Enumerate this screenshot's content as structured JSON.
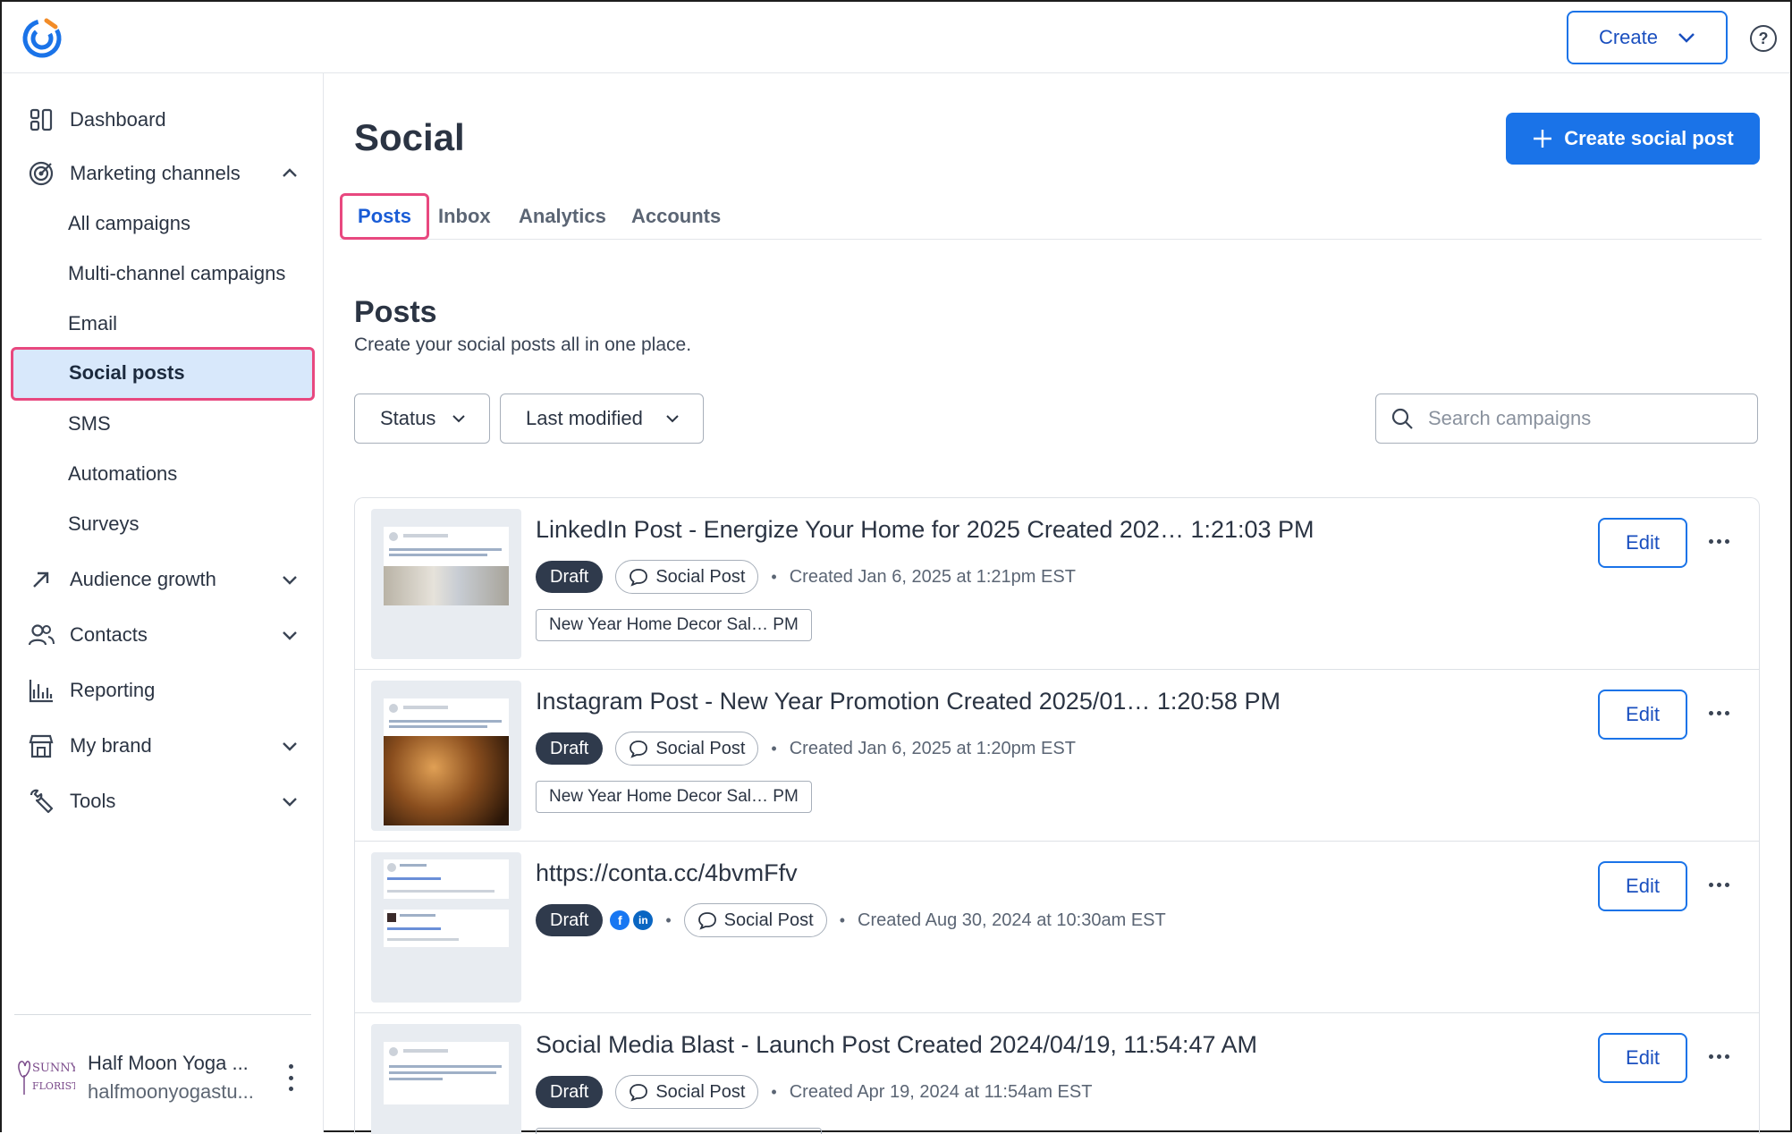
{
  "header": {
    "create_label": "Create",
    "help_icon": "help-circle-icon"
  },
  "sidebar": {
    "items": [
      {
        "label": "Dashboard",
        "icon": "dashboard-icon"
      },
      {
        "label": "Marketing channels",
        "icon": "target-icon"
      },
      {
        "label": "Audience growth",
        "icon": "arrow-up-right-icon"
      },
      {
        "label": "Contacts",
        "icon": "contacts-icon"
      },
      {
        "label": "Reporting",
        "icon": "chart-icon"
      },
      {
        "label": "My brand",
        "icon": "store-icon"
      },
      {
        "label": "Tools",
        "icon": "wrench-icon"
      }
    ],
    "subitems": [
      "All campaigns",
      "Multi-channel campaigns",
      "Email",
      "Social posts",
      "SMS",
      "Automations",
      "Surveys"
    ],
    "account": {
      "name": "Half Moon Yoga ...",
      "email": "halfmoonyogastu...",
      "logo_text_1": "SUNNY'S",
      "logo_text_2": "FLORIST"
    }
  },
  "main": {
    "title": "Social",
    "cta_label": "Create social post",
    "tabs": [
      "Posts",
      "Inbox",
      "Analytics",
      "Accounts"
    ],
    "section_title": "Posts",
    "section_subtitle": "Create your social posts all in one place.",
    "filters": {
      "status": "Status",
      "last_modified": "Last modified"
    },
    "search": {
      "placeholder": "Search campaigns"
    }
  },
  "posts": [
    {
      "title": "LinkedIn Post - Energize Your Home for 2025 Created 202… 1:21:03 PM",
      "status": "Draft",
      "type": "Social Post",
      "created": "Created Jan 6, 2025 at 1:21pm EST",
      "tag": "New Year Home Decor Sal… PM",
      "edit": "Edit"
    },
    {
      "title": "Instagram Post - New Year Promotion Created 2025/01… 1:20:58 PM",
      "status": "Draft",
      "type": "Social Post",
      "created": "Created Jan 6, 2025 at 1:20pm EST",
      "tag": "New Year Home Decor Sal… PM",
      "edit": "Edit"
    },
    {
      "title": "https://conta.cc/4bvmFfv",
      "status": "Draft",
      "type": "Social Post",
      "created": "Created Aug 30, 2024 at 10:30am EST",
      "tag": "",
      "edit": "Edit"
    },
    {
      "title": "Social Media Blast - Launch Post Created 2024/04/19, 11:54:47 AM",
      "status": "Draft",
      "type": "Social Post",
      "created": "Created Apr 19, 2024 at 11:54am EST",
      "tag": "",
      "edit": "Edit"
    }
  ],
  "colors": {
    "primary": "#1a73e8",
    "highlight": "#e8487f",
    "active_bg": "#d8e8fb",
    "draft_bg": "#2f3a4c"
  }
}
